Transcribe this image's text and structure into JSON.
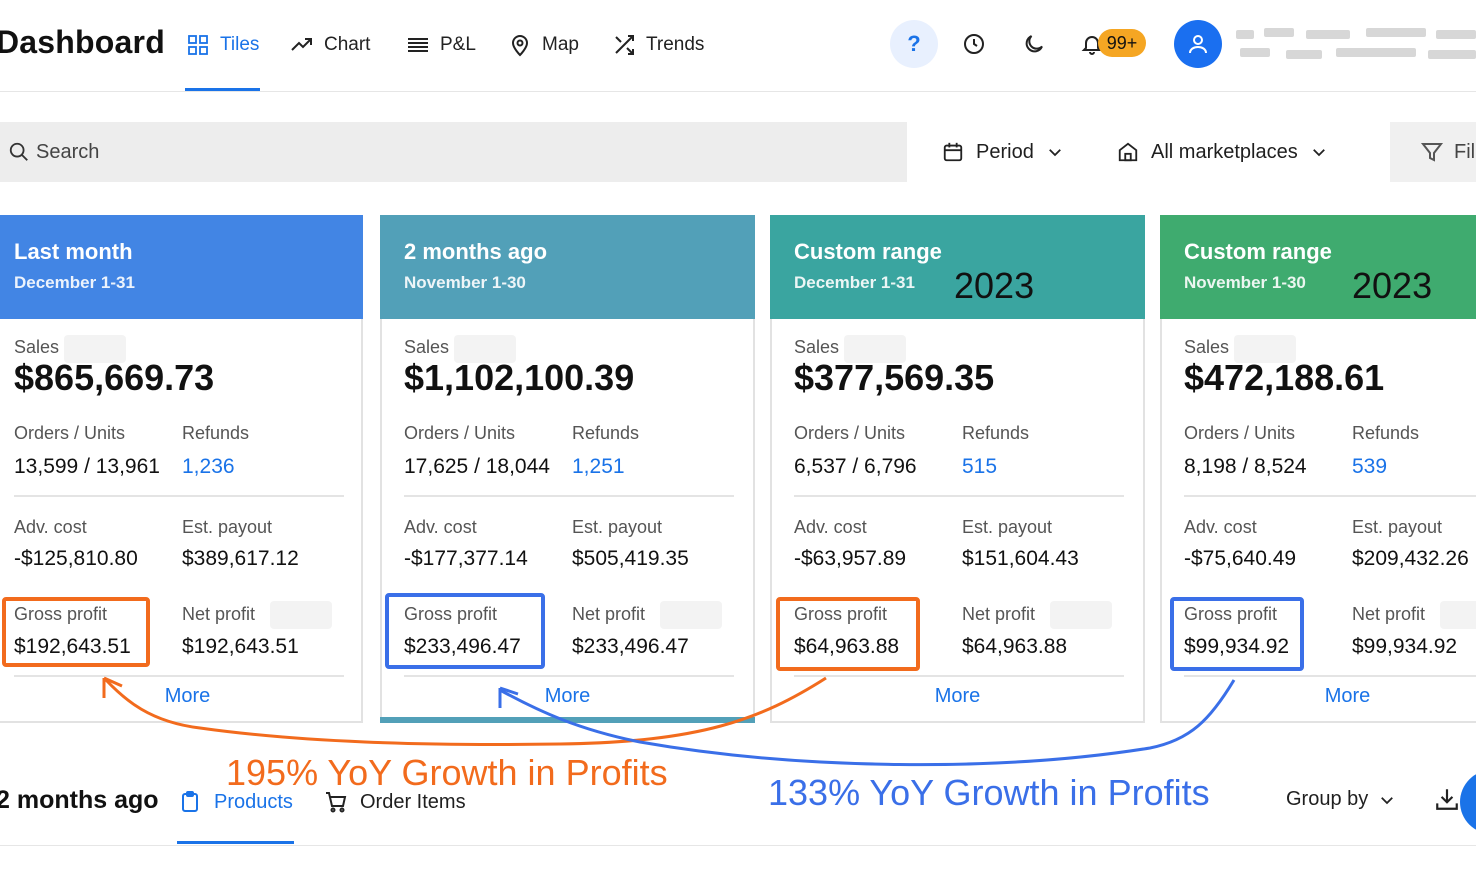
{
  "header": {
    "title": "Dashboard",
    "nav": [
      {
        "label": "Tiles",
        "icon": "grid-icon",
        "active": true
      },
      {
        "label": "Chart",
        "icon": "trend-line-icon"
      },
      {
        "label": "P&L",
        "icon": "list-lines-icon"
      },
      {
        "label": "Map",
        "icon": "map-pin-icon"
      },
      {
        "label": "Trends",
        "icon": "shuffle-icon"
      }
    ],
    "help_label": "?",
    "notification_count": "99+"
  },
  "toolbar": {
    "search_placeholder": "Search",
    "period_label": "Period",
    "marketplaces_label": "All marketplaces",
    "filter_label": "Fil"
  },
  "tiles": [
    {
      "title": "Last month",
      "subtitle": "December 1-31",
      "year": "",
      "color": "#4285e4",
      "sales_label": "Sales",
      "sales": "$865,669.73",
      "orders_label": "Orders / Units",
      "orders": "13,599 / 13,961",
      "refunds_label": "Refunds",
      "refunds": "1,236",
      "adv_label": "Adv. cost",
      "adv": "-$125,810.80",
      "payout_label": "Est. payout",
      "payout": "$389,617.12",
      "gross_label": "Gross profit",
      "gross": "$192,643.51",
      "net_label": "Net profit",
      "net": "$192,643.51",
      "more": "More"
    },
    {
      "title": "2 months ago",
      "subtitle": "November 1-30",
      "year": "",
      "color": "#52a0b8",
      "sales_label": "Sales",
      "sales": "$1,102,100.39",
      "orders_label": "Orders / Units",
      "orders": "17,625 / 18,044",
      "refunds_label": "Refunds",
      "refunds": "1,251",
      "adv_label": "Adv. cost",
      "adv": "-$177,377.14",
      "payout_label": "Est. payout",
      "payout": "$505,419.35",
      "gross_label": "Gross profit",
      "gross": "$233,496.47",
      "net_label": "Net profit",
      "net": "$233,496.47",
      "more": "More"
    },
    {
      "title": "Custom range",
      "subtitle": "December 1-31",
      "year": "2023",
      "color": "#3aa5a0",
      "sales_label": "Sales",
      "sales": "$377,569.35",
      "orders_label": "Orders / Units",
      "orders": "6,537 / 6,796",
      "refunds_label": "Refunds",
      "refunds": "515",
      "adv_label": "Adv. cost",
      "adv": "-$63,957.89",
      "payout_label": "Est. payout",
      "payout": "$151,604.43",
      "gross_label": "Gross profit",
      "gross": "$64,963.88",
      "net_label": "Net profit",
      "net": "$64,963.88",
      "more": "More"
    },
    {
      "title": "Custom range",
      "subtitle": "November 1-30",
      "year": "2023",
      "color": "#3fab6f",
      "sales_label": "Sales",
      "sales": "$472,188.61",
      "orders_label": "Orders / Units",
      "orders": "8,198 / 8,524",
      "refunds_label": "Refunds",
      "refunds": "539",
      "adv_label": "Adv. cost",
      "adv": "-$75,640.49",
      "payout_label": "Est. payout",
      "payout": "$209,432.26",
      "gross_label": "Gross profit",
      "gross": "$99,934.92",
      "net_label": "Net profit",
      "net": "$99,934.92",
      "more": "More"
    }
  ],
  "bottom": {
    "title": "2 months ago",
    "tabs": [
      {
        "label": "Products",
        "icon": "clipboard-icon",
        "active": true
      },
      {
        "label": "Order Items",
        "icon": "cart-icon"
      }
    ],
    "group_by_label": "Group by"
  },
  "annotations": {
    "orange": "195% YoY Growth in Profits",
    "blue": "133% YoY Growth in Profits"
  },
  "colors": {
    "accent": "#1a73e8",
    "orange_annotation": "#f26b1d",
    "blue_annotation": "#3a6fe8",
    "badge": "#f5a623"
  }
}
